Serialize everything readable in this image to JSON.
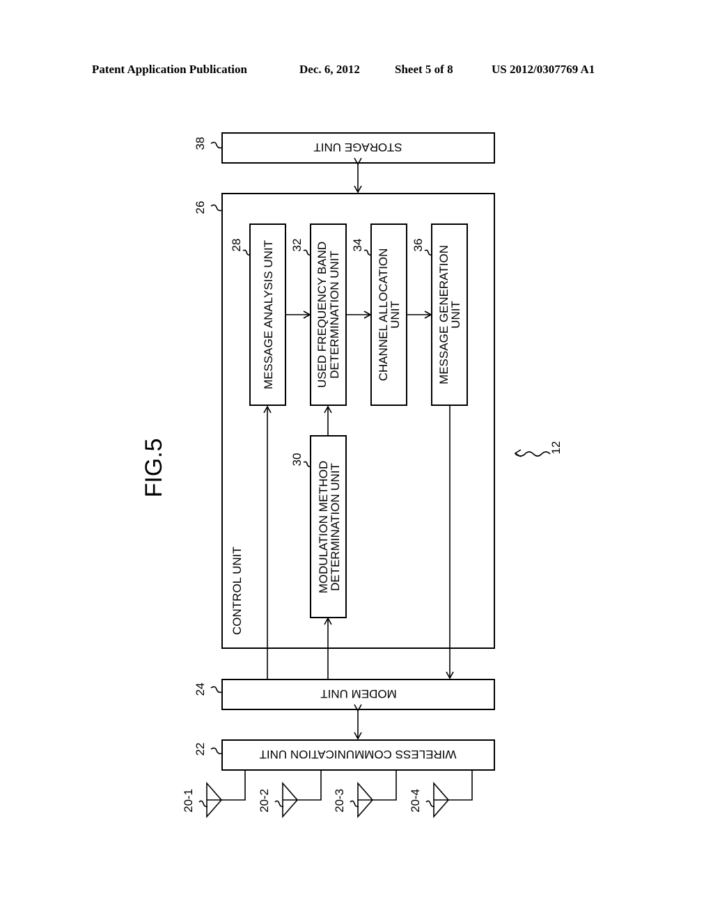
{
  "header": {
    "publication": "Patent Application Publication",
    "date": "Dec. 6, 2012",
    "sheet": "Sheet 5 of 8",
    "number": "US 2012/0307769 A1"
  },
  "figure": {
    "title": "FIG.5",
    "device_ref": "12",
    "blocks": {
      "storage": {
        "ref": "38",
        "label": "STORAGE UNIT"
      },
      "control": {
        "ref": "26",
        "label": "CONTROL UNIT"
      },
      "message_analysis": {
        "ref": "28",
        "label": "MESSAGE ANALYSIS UNIT"
      },
      "used_frequency": {
        "ref": "32",
        "line1": "USED FREQUENCY BAND",
        "line2": "DETERMINATION UNIT"
      },
      "channel_allocation": {
        "ref": "34",
        "line1": "CHANNEL ALLOCATION",
        "line2": "UNIT"
      },
      "message_generation": {
        "ref": "36",
        "line1": "MESSAGE GENERATION",
        "line2": "UNIT"
      },
      "modulation": {
        "ref": "30",
        "line1": "MODULATION METHOD",
        "line2": "DETERMINATION UNIT"
      },
      "modem": {
        "ref": "24",
        "label": "MODEM UNIT"
      },
      "wireless": {
        "ref": "22",
        "label": "WIRELESS COMMUNICATION UNIT"
      }
    },
    "antennas": [
      {
        "ref": "20-1"
      },
      {
        "ref": "20-2"
      },
      {
        "ref": "20-3"
      },
      {
        "ref": "20-4"
      }
    ]
  }
}
